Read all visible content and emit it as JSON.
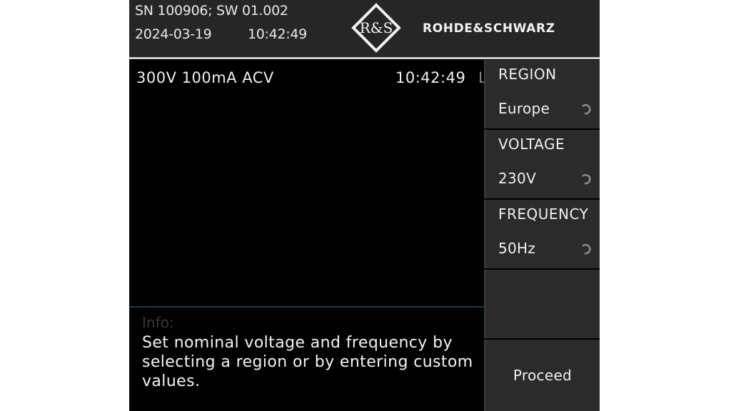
{
  "header": {
    "serial_line": "SN 100906; SW 01.002",
    "date": "2024-03-19",
    "time": "10:42:49",
    "logo_letters": "R&S",
    "brand": "ROHDE&SCHWARZ"
  },
  "status_bar": {
    "range": "300V  100mA  ACV",
    "time": "10:42:49",
    "clipped": "L"
  },
  "info": {
    "label": "Info:",
    "message": "Set nominal voltage and frequency by selecting a region or by entering custom values."
  },
  "softkeys": [
    {
      "title": "REGION",
      "value": "Europe",
      "icon": "rotary-knob-icon"
    },
    {
      "title": "VOLTAGE",
      "value": "230V",
      "icon": "rotary-knob-icon"
    },
    {
      "title": "FREQUENCY",
      "value": "50Hz",
      "icon": "rotary-knob-icon"
    },
    {
      "label": ""
    },
    {
      "label": "Proceed"
    }
  ],
  "colors": {
    "header_bg": "#262626",
    "screen_bg": "#000000",
    "softkey_bg": "#2b2b2b",
    "text": "#efefef",
    "info_label": "#3a3a3a"
  }
}
